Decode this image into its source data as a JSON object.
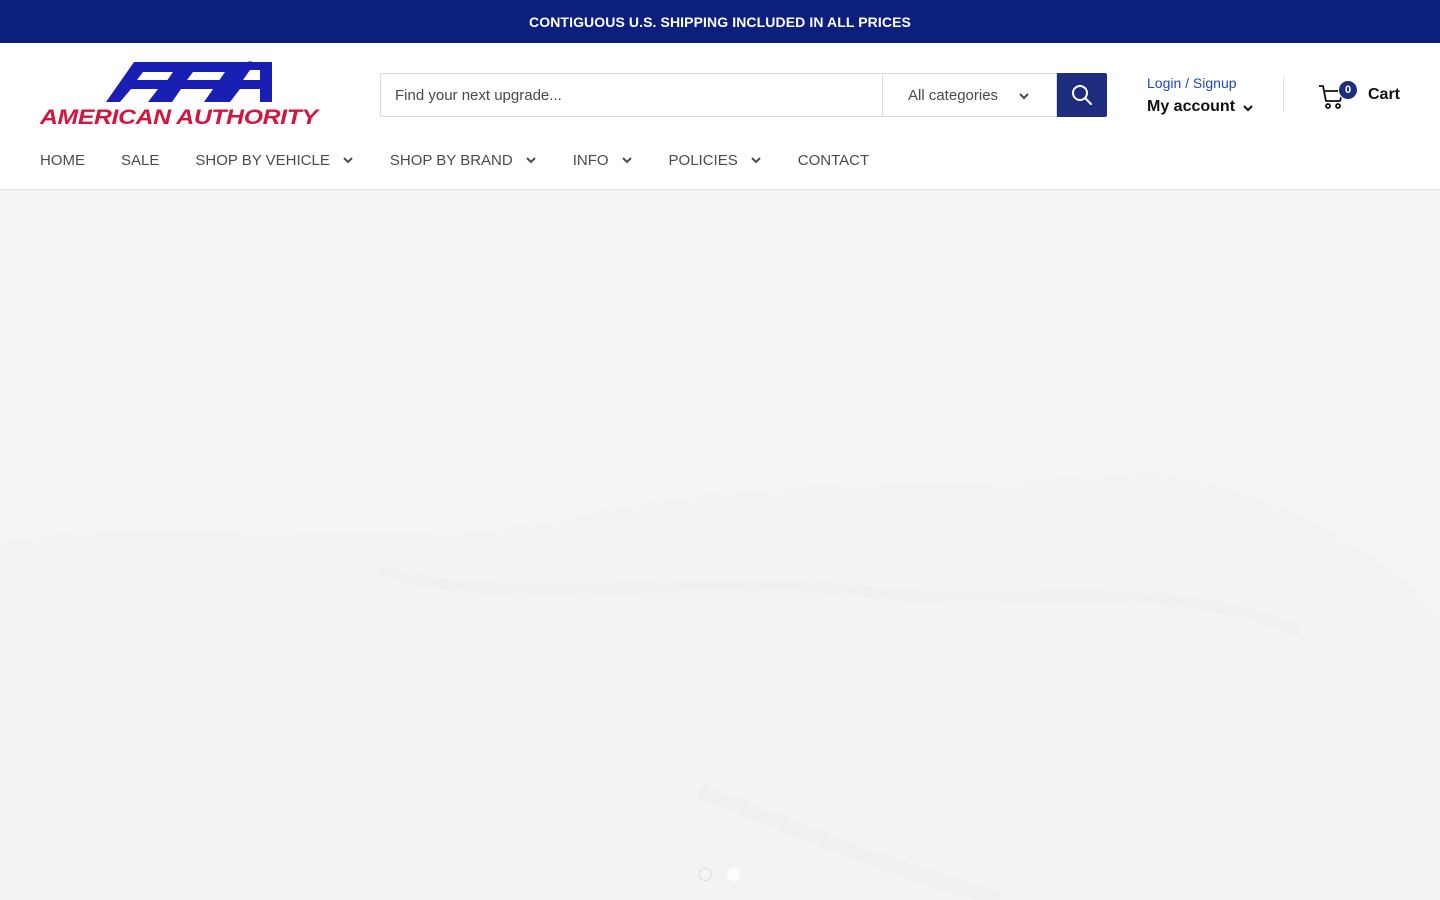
{
  "announcement": {
    "text": "CONTIGUOUS U.S. SHIPPING INCLUDED IN ALL PRICES"
  },
  "logo": {
    "text": "AMERICAN AUTHORITY",
    "monogram": "AA",
    "mark": "®"
  },
  "search": {
    "placeholder": "Find your next upgrade...",
    "category": "All categories",
    "button_icon": "search-icon"
  },
  "account": {
    "login_label": "Login / Signup",
    "account_label": "My account"
  },
  "cart": {
    "count": "0",
    "label": "Cart",
    "icon": "cart-icon"
  },
  "nav": [
    {
      "label": "HOME",
      "dropdown": false
    },
    {
      "label": "SALE",
      "dropdown": false
    },
    {
      "label": "SHOP BY VEHICLE",
      "dropdown": true
    },
    {
      "label": "SHOP BY BRAND",
      "dropdown": true
    },
    {
      "label": "INFO",
      "dropdown": true
    },
    {
      "label": "POLICIES",
      "dropdown": true
    },
    {
      "label": "CONTACT",
      "dropdown": false
    }
  ],
  "slideshow": {
    "slides": 2,
    "active_slide": 2
  },
  "colors": {
    "brand_blue": "#1e2d7d",
    "announcement_bg": "#0d1f7d",
    "logo_red": "#d1163f",
    "logo_blue": "#1a1fb3",
    "link_blue": "#1e4ab3",
    "hero_bg": "#f3f5f6"
  }
}
